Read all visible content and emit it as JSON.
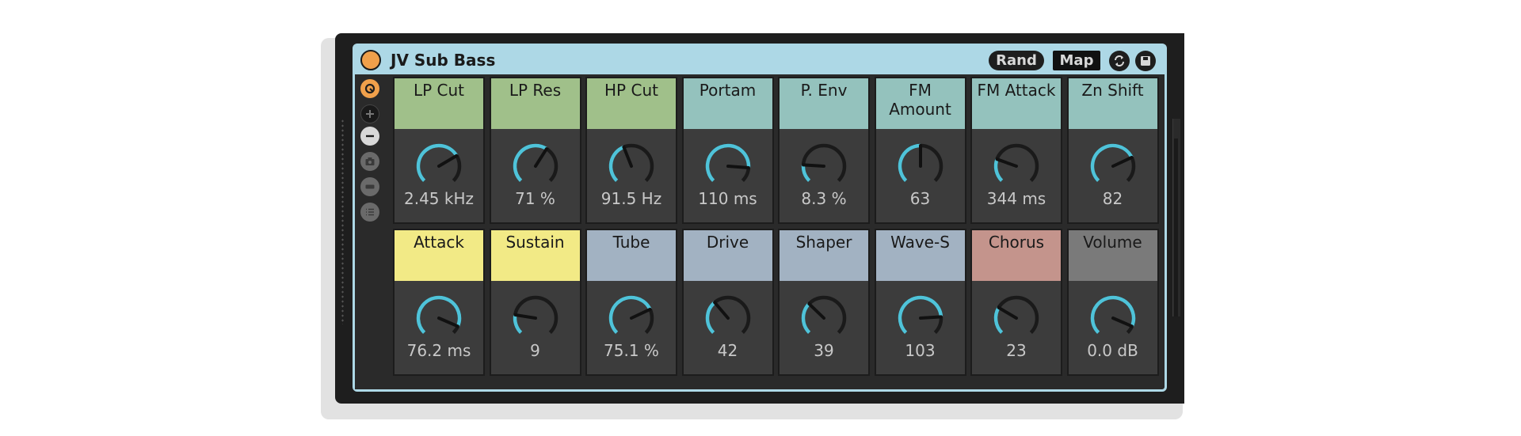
{
  "device": {
    "title": "JV Sub Bass",
    "buttons": {
      "rand": "Rand",
      "map": "Map"
    },
    "colors": {
      "frame": "#add8e6",
      "power": "#f0a04b",
      "knob_arc": "#4fc3d9"
    }
  },
  "sidebar": {
    "icons": [
      "hot-swap-icon",
      "plus-icon",
      "minus-icon",
      "camera-icon",
      "card-icon",
      "list-icon"
    ]
  },
  "macros": [
    {
      "label": "LP Cut",
      "value": "2.45 kHz",
      "color": "#a0c08a",
      "level": 0.72
    },
    {
      "label": "LP Res",
      "value": "71 %",
      "color": "#a0c08a",
      "level": 0.62
    },
    {
      "label": "HP Cut",
      "value": "91.5 Hz",
      "color": "#a0c08a",
      "level": 0.42
    },
    {
      "label": "Portam",
      "value": "110 ms",
      "color": "#94c2bd",
      "level": 0.85
    },
    {
      "label": "P. Env",
      "value": "8.3 %",
      "color": "#94c2bd",
      "level": 0.18
    },
    {
      "label": "FM Amount",
      "value": "63",
      "color": "#94c2bd",
      "level": 0.5
    },
    {
      "label": "FM Attack",
      "value": "344 ms",
      "color": "#94c2bd",
      "level": 0.24
    },
    {
      "label": "Zn Shift",
      "value": "82",
      "color": "#94c2bd",
      "level": 0.74
    },
    {
      "label": "Attack",
      "value": "76.2 ms",
      "color": "#f2ea86",
      "level": 0.92
    },
    {
      "label": "Sustain",
      "value": "9",
      "color": "#f2ea86",
      "level": 0.2
    },
    {
      "label": "Tube",
      "value": "75.1 %",
      "color": "#a2b2c2",
      "level": 0.74
    },
    {
      "label": "Drive",
      "value": "42",
      "color": "#a2b2c2",
      "level": 0.35
    },
    {
      "label": "Shaper",
      "value": "39",
      "color": "#a2b2c2",
      "level": 0.33
    },
    {
      "label": "Wave-S",
      "value": "103",
      "color": "#a2b2c2",
      "level": 0.82
    },
    {
      "label": "Chorus",
      "value": "23",
      "color": "#c4948c",
      "level": 0.28
    },
    {
      "label": "Volume",
      "value": "0.0 dB",
      "color": "#7a7a7a",
      "level": 0.92
    }
  ]
}
